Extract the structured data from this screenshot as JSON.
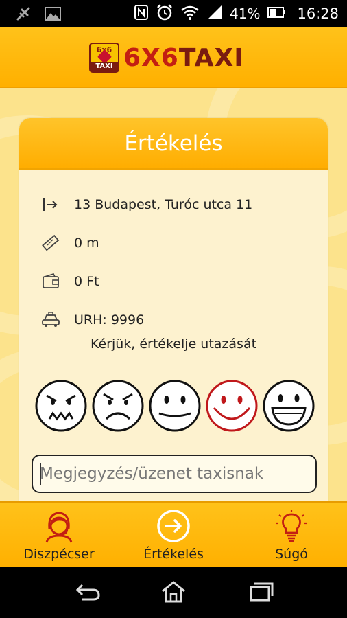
{
  "status_bar": {
    "battery_percent": "41%",
    "time": "16:28",
    "icons": [
      "signal-off-icon",
      "image-icon",
      "nfc-icon",
      "alarm-icon",
      "wifi-icon",
      "cellular-icon",
      "battery-icon"
    ]
  },
  "header": {
    "logo_badge_top": "6x6",
    "logo_badge_bottom": "TAXI",
    "logo_text_a": "6X6",
    "logo_text_b": "TAXI"
  },
  "card": {
    "title": "Értékelés",
    "rows": [
      {
        "icon": "destination-arrow-icon",
        "text": "13 Budapest, Turóc utca 11"
      },
      {
        "icon": "ruler-icon",
        "text": "0 m"
      },
      {
        "icon": "wallet-icon",
        "text": "0 Ft"
      },
      {
        "icon": "taxi-icon",
        "text": "URH: 9996"
      }
    ],
    "prompt": "Kérjük, értékelje utazását",
    "faces": [
      "very-angry-face",
      "sad-face",
      "neutral-face",
      "happy-face",
      "very-happy-face"
    ],
    "selected_face": "happy-face",
    "message_placeholder": "Megjegyzés/üzenet taxisnak",
    "message_value": ""
  },
  "bottom_nav": {
    "items": [
      {
        "label": "Diszpécser",
        "icon": "dispatcher-icon"
      },
      {
        "label": "Értékelés",
        "icon": "arrow-right-circle-icon"
      },
      {
        "label": "Súgó",
        "icon": "lightbulb-icon"
      }
    ],
    "active": "Értékelés"
  },
  "colors": {
    "accent": "#ffb000",
    "card_bg": "#fdf2cf",
    "selected_face": "#c0181b",
    "logo_red": "#c31f12",
    "logo_dark": "#7a1b10"
  }
}
